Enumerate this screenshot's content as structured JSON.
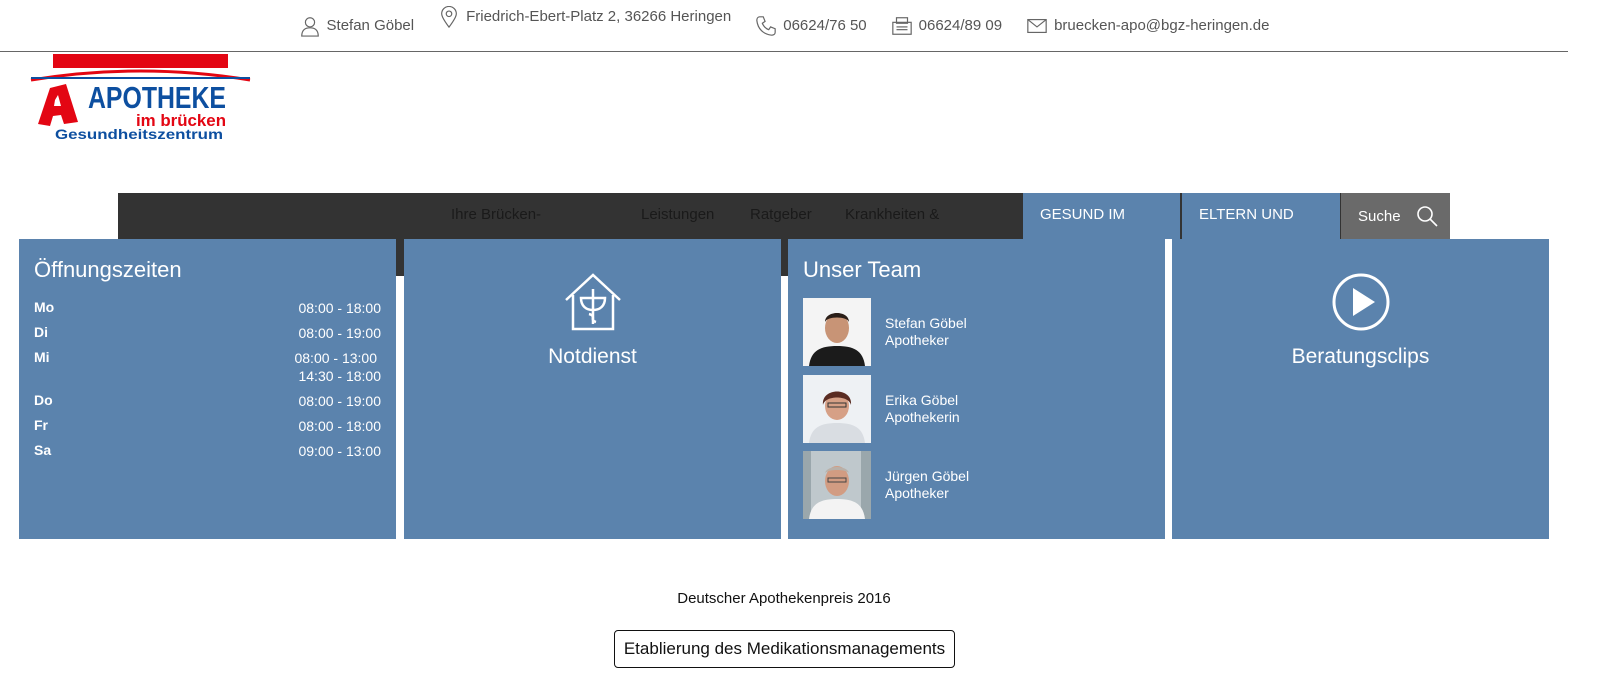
{
  "contact": {
    "name": "Stefan Göbel",
    "address": "Friedrich-Ebert-Platz 2, 36266 Heringen",
    "phone": "06624/76 50",
    "fax": "06624/89 09",
    "email": "bruecken-apo@bgz-heringen.de"
  },
  "logo": {
    "line1": "APOTHEKE",
    "line2": "im brücken",
    "line3": "Gesundheitszentrum",
    "colors": {
      "red": "#e30613",
      "blue": "#0d4fa0"
    }
  },
  "nav": {
    "items": [
      "Ihre Brücken-",
      "Leistungen",
      "Ratgeber",
      "Krankheiten &"
    ],
    "highlight": [
      "GESUND IM",
      "ELTERN UND"
    ],
    "search_label": "Suche"
  },
  "hours": {
    "title": "Öffnungszeiten",
    "rows": [
      {
        "day": "Mo",
        "time": "08:00 - 18:00"
      },
      {
        "day": "Di",
        "time": "08:00 - 19:00"
      },
      {
        "day": "Mi",
        "time": "08:00 - 13:00",
        "time2": "14:30 - 18:00"
      },
      {
        "day": "Do",
        "time": "08:00 - 19:00"
      },
      {
        "day": "Fr",
        "time": "08:00 - 18:00"
      },
      {
        "day": "Sa",
        "time": "09:00 - 13:00"
      }
    ]
  },
  "notdienst": {
    "label": "Notdienst"
  },
  "team": {
    "title": "Unser Team",
    "members": [
      {
        "name": "Stefan Göbel",
        "role": "Apotheker"
      },
      {
        "name": "Erika Göbel",
        "role": "Apothekerin"
      },
      {
        "name": "Jürgen Göbel",
        "role": "Apotheker"
      }
    ]
  },
  "clips": {
    "label": "Beratungsclips"
  },
  "award": {
    "text": "Deutscher Apothekenpreis 2016",
    "button": "Etablierung des Medikationsmanagements"
  },
  "colors": {
    "panel_blue": "#5b83ad",
    "nav_dark": "#333333",
    "search_gray": "#6a6a6a"
  }
}
